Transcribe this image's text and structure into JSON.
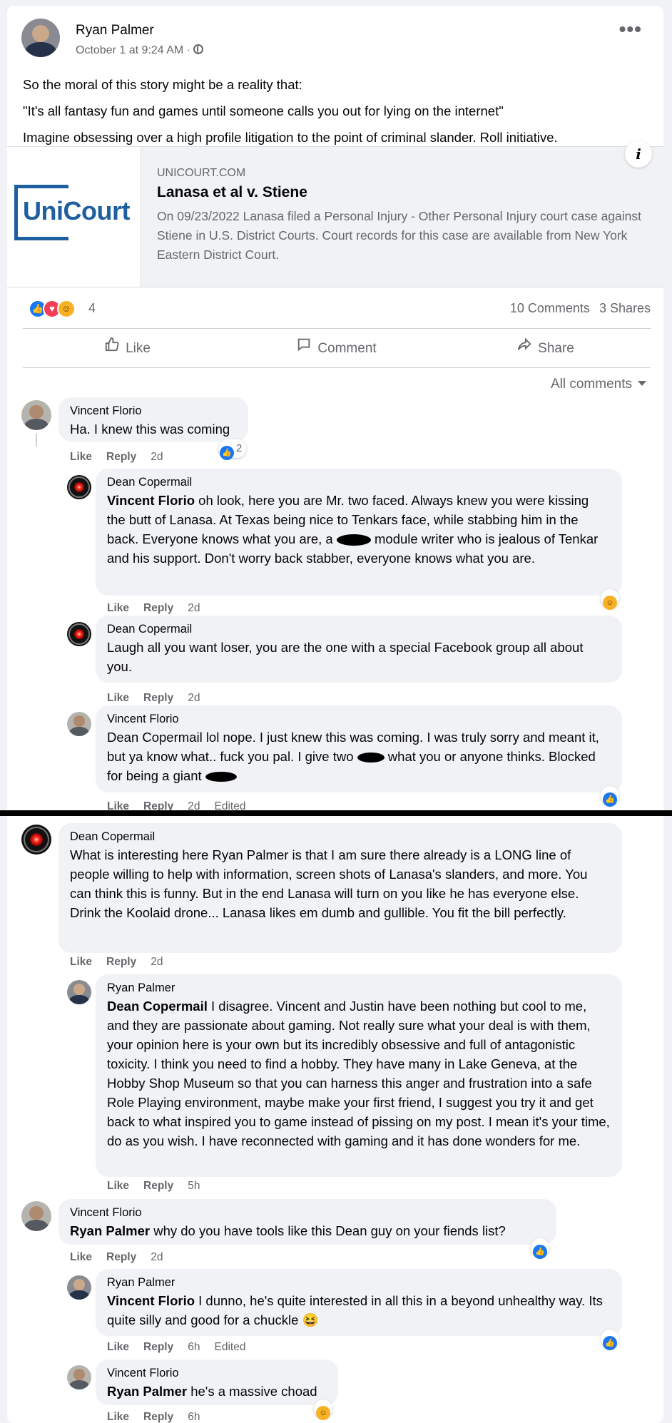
{
  "post": {
    "author": "Ryan Palmer",
    "time": "October 1 at 9:24 AM ·",
    "more_label": "•••",
    "lines": [
      "So the moral of this story might be a reality that:",
      "\"It's all fantasy fun and games until someone calls you out for lying on the internet\"",
      "Imagine obsessing over a high profile litigation to the point of criminal slander. Roll initiative."
    ]
  },
  "link": {
    "logo_text": "UniCourt",
    "domain": "UNICOURT.COM",
    "title": "Lanasa et al v. Stiene",
    "description": "On 09/23/2022 Lanasa filed a Personal Injury - Other Personal Injury court case against Stiene in U.S. District Courts. Court records for this case are available from New York Eastern District Court.",
    "info_glyph": "i"
  },
  "reactions": {
    "count": "4",
    "comments": "10 Comments",
    "shares": "3 Shares",
    "icons": [
      "like-icon",
      "love-icon",
      "haha-icon"
    ]
  },
  "actions": {
    "like": "Like",
    "comment": "Comment",
    "share": "Share"
  },
  "filter": {
    "label": "All comments"
  },
  "labels": {
    "like": "Like",
    "reply": "Reply",
    "edited": "Edited"
  },
  "comments": [
    {
      "author": "Vincent Florio",
      "text": "Ha. I knew this was coming",
      "time": "2d",
      "reaction_count": "2"
    },
    {
      "author": "Dean Copermail",
      "mention": "Vincent Florio",
      "text_a": " oh look, here you are Mr. two faced. Always knew you were kissing the butt of Lanasa. At Texas being nice to Tenkars face, while stabbing him in the back. Everyone knows what you are, a ",
      "text_b": " module writer who is jealous of Tenkar and his support. Don't worry back stabber, everyone knows what you are.",
      "time": "2d"
    },
    {
      "author": "Dean Copermail",
      "text": "Laugh all you want loser, you are the one with a special Facebook group all about you.",
      "time": "2d"
    },
    {
      "author": "Vincent Florio",
      "text_a": "Dean Copermail lol nope. I just knew this was coming. I was truly sorry and meant it, but ya know what.. fuck you pal. I give two ",
      "text_b": " what you or anyone thinks. Blocked for being a giant ",
      "time": "2d"
    },
    {
      "author": "Dean Copermail",
      "text": "What is interesting here Ryan Palmer is that I am sure there already is a LONG line of people willing to help with information, screen shots of Lanasa's slanders, and more. You can think this is funny. But in the end Lanasa will turn on you like he has everyone else. Drink the Koolaid drone... Lanasa likes em dumb and gullible. You fit the bill perfectly.",
      "time": "2d"
    },
    {
      "author": "Ryan Palmer",
      "mention": "Dean Copermail",
      "text": " I disagree. Vincent and Justin have been nothing but cool to me, and they are passionate about gaming. Not really sure what your deal is with them, your opinion here is your own but its incredibly obsessive and full of antagonistic toxicity. I think you need to find a hobby. They have many in Lake Geneva, at the Hobby Shop Museum so that you can harness this anger and frustration into a safe Role Playing environment, maybe make your first friend, I suggest you try it and get back to what inspired you to game instead of pissing on my post. I mean it's your time, do as you wish. I have reconnected with gaming and it has done wonders for me.",
      "time": "5h"
    },
    {
      "author": "Vincent Florio",
      "mention": "Ryan Palmer",
      "text": " why do you have tools like this Dean guy on your fiends list?",
      "time": "2d"
    },
    {
      "author": "Ryan Palmer",
      "mention": "Vincent Florio",
      "text": " I dunno, he's quite interested in all this in a beyond unhealthy way. Its quite silly and good for a chuckle",
      "emoji": "😆",
      "time": "6h"
    },
    {
      "author": "Vincent Florio",
      "mention": "Ryan Palmer",
      "text": " he's a massive choad",
      "time": "6h"
    }
  ]
}
